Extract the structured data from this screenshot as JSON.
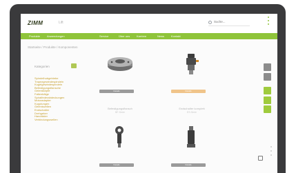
{
  "header": {
    "logo": "ZIMM",
    "logo_sub": "Lift",
    "search_placeholder": "Suche..."
  },
  "nav": {
    "items": [
      "Produkte",
      "Anwendungen",
      "Service",
      "Über uns",
      "Karriere",
      "News",
      "Kontakt"
    ]
  },
  "breadcrumb": "Startseite / Produkte / Komponenten",
  "filter": {
    "title": "Kategorien",
    "categories": [
      "Spindelhubgetriebe",
      "Trapezgewindespindeln",
      "Kugelgewindespindeln",
      "Befestigungsflansche",
      "Gelenkköpfe",
      "Faltenbälge",
      "Spiralfederabdeckungen",
      "Motoradapter",
      "Kupplungen",
      "Gelenkwellen",
      "Endschalter",
      "Drehgeber",
      "Handräder",
      "Verbindungswellen"
    ]
  },
  "products": [
    {
      "name": "Befestigungsflansch",
      "sub": "BF-Serie",
      "button": "Details"
    },
    {
      "name": "Endschalter komplett",
      "sub": "ES-Serie",
      "button": "Details"
    },
    {
      "name": "Gelenkkopf",
      "sub": "GK-Serie",
      "button": "Details"
    },
    {
      "name": "Motoradapter",
      "sub": "MA-Serie",
      "button": "Details"
    }
  ],
  "colors": {
    "brand_green": "#8fc43a",
    "frame": "#3a3a3c",
    "category_text": "#c7a02e",
    "button_grey": "#9a9a9a",
    "button_highlight": "#f0c48a"
  }
}
